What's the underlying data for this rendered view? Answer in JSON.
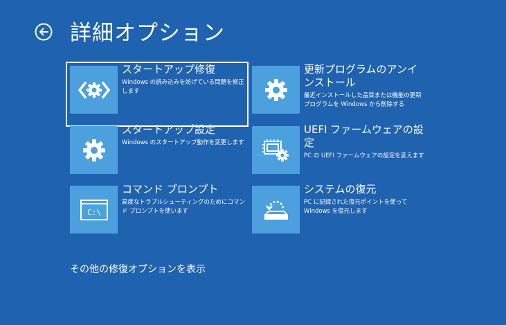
{
  "header": {
    "title": "詳細オプション"
  },
  "options": [
    {
      "title": "スタートアップ修復",
      "description": "Windows の読み込みを妨げている問題を修正します",
      "icon": "startup-repair-icon"
    },
    {
      "title": "更新プログラムのアンインストール",
      "description": "最近インストールした品質または機能の更新プログラムを Windows から削除する",
      "icon": "gear-icon"
    },
    {
      "title": "スタートアップ設定",
      "description": "Windows のスタートアップ動作を変更します",
      "icon": "gear-icon"
    },
    {
      "title": "UEFI ファームウェアの設定",
      "description": "PC の UEFI ファームウェアの設定を変えます",
      "icon": "firmware-settings-icon"
    },
    {
      "title": "コマンド プロンプト",
      "description": "高度なトラブルシューティングのためにコマンド プロンプトを使います",
      "icon": "command-prompt-icon",
      "icon_text": "C:\\"
    },
    {
      "title": "システムの復元",
      "description": "PC に記録された復元ポイントを使って Windows を復元します",
      "icon": "system-restore-icon"
    }
  ],
  "footer": {
    "more_options_link": "その他の修復オプションを表示"
  },
  "colors": {
    "background": "#1f62b0",
    "tile": "#4ca0dd",
    "text": "#ffffff"
  }
}
